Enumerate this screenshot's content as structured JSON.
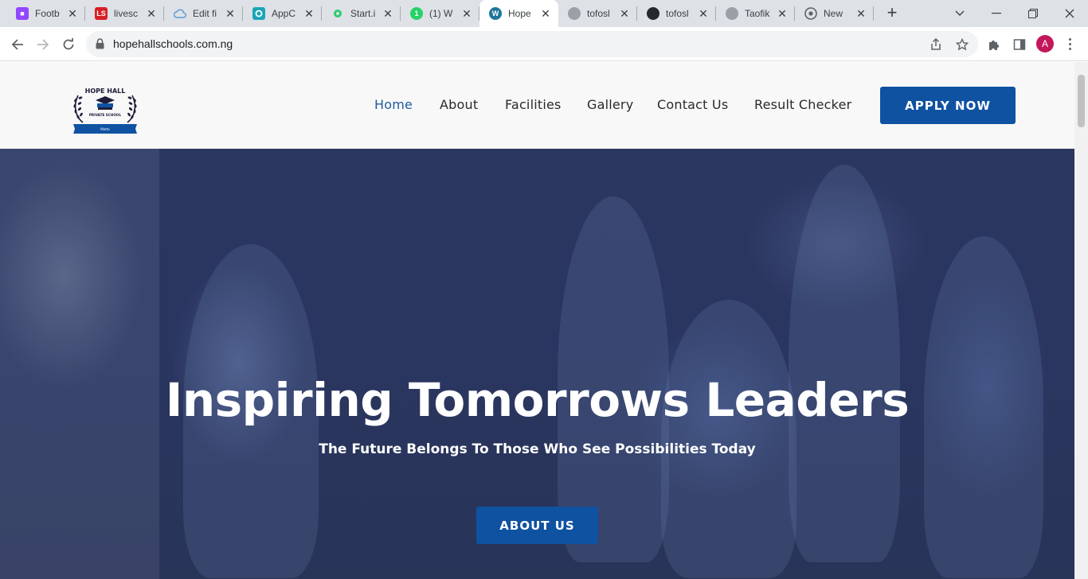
{
  "browser": {
    "tabs": [
      {
        "title": "Footb",
        "icon": "twitch-icon",
        "color": "#9146ff"
      },
      {
        "title": "livesc",
        "icon": "livescore-icon",
        "color": "#d81f26"
      },
      {
        "title": "Edit fi",
        "icon": "cloud-icon",
        "color": "#5b9bd5"
      },
      {
        "title": "AppC",
        "icon": "appcircle-icon",
        "color": "#1aa6b7"
      },
      {
        "title": "Start.i",
        "icon": "start-icon",
        "color": "#2ecc71"
      },
      {
        "title": "(1) W",
        "icon": "whatsapp-icon",
        "color": "#25d366"
      },
      {
        "title": "Hope",
        "icon": "wordpress-icon",
        "color": "#21759b"
      },
      {
        "title": "tofosl",
        "icon": "globe-icon",
        "color": "#9aa0a6"
      },
      {
        "title": "tofosl",
        "icon": "github-icon",
        "color": "#24292e"
      },
      {
        "title": "Taofik",
        "icon": "globe-icon",
        "color": "#9aa0a6"
      },
      {
        "title": "New",
        "icon": "chrome-icon",
        "color": "#5f6368"
      }
    ],
    "active_tab_index": 6,
    "url": "hopehallschools.com.ng",
    "profile_initial": "A"
  },
  "site": {
    "logo_text": {
      "top": "HOPE HALL",
      "middle": "PRIVATE SCHOOL",
      "ribbon": "Motto"
    },
    "nav": [
      {
        "label": "Home",
        "active": true
      },
      {
        "label": "About",
        "active": false
      },
      {
        "label": "Facilities",
        "active": false
      },
      {
        "label": "Gallery",
        "active": false
      },
      {
        "label": "Contact Us",
        "active": false
      },
      {
        "label": "Result Checker",
        "active": false
      }
    ],
    "apply_label": "APPLY NOW",
    "hero": {
      "title": "Inspiring Tomorrows Leaders",
      "subtitle": "The Future Belongs To Those Who See Possibilities Today",
      "button_label": "ABOUT US"
    },
    "colors": {
      "primary": "#0f52a2",
      "active_nav": "#1f5b9c",
      "hero_overlay": "#2c3760"
    }
  }
}
